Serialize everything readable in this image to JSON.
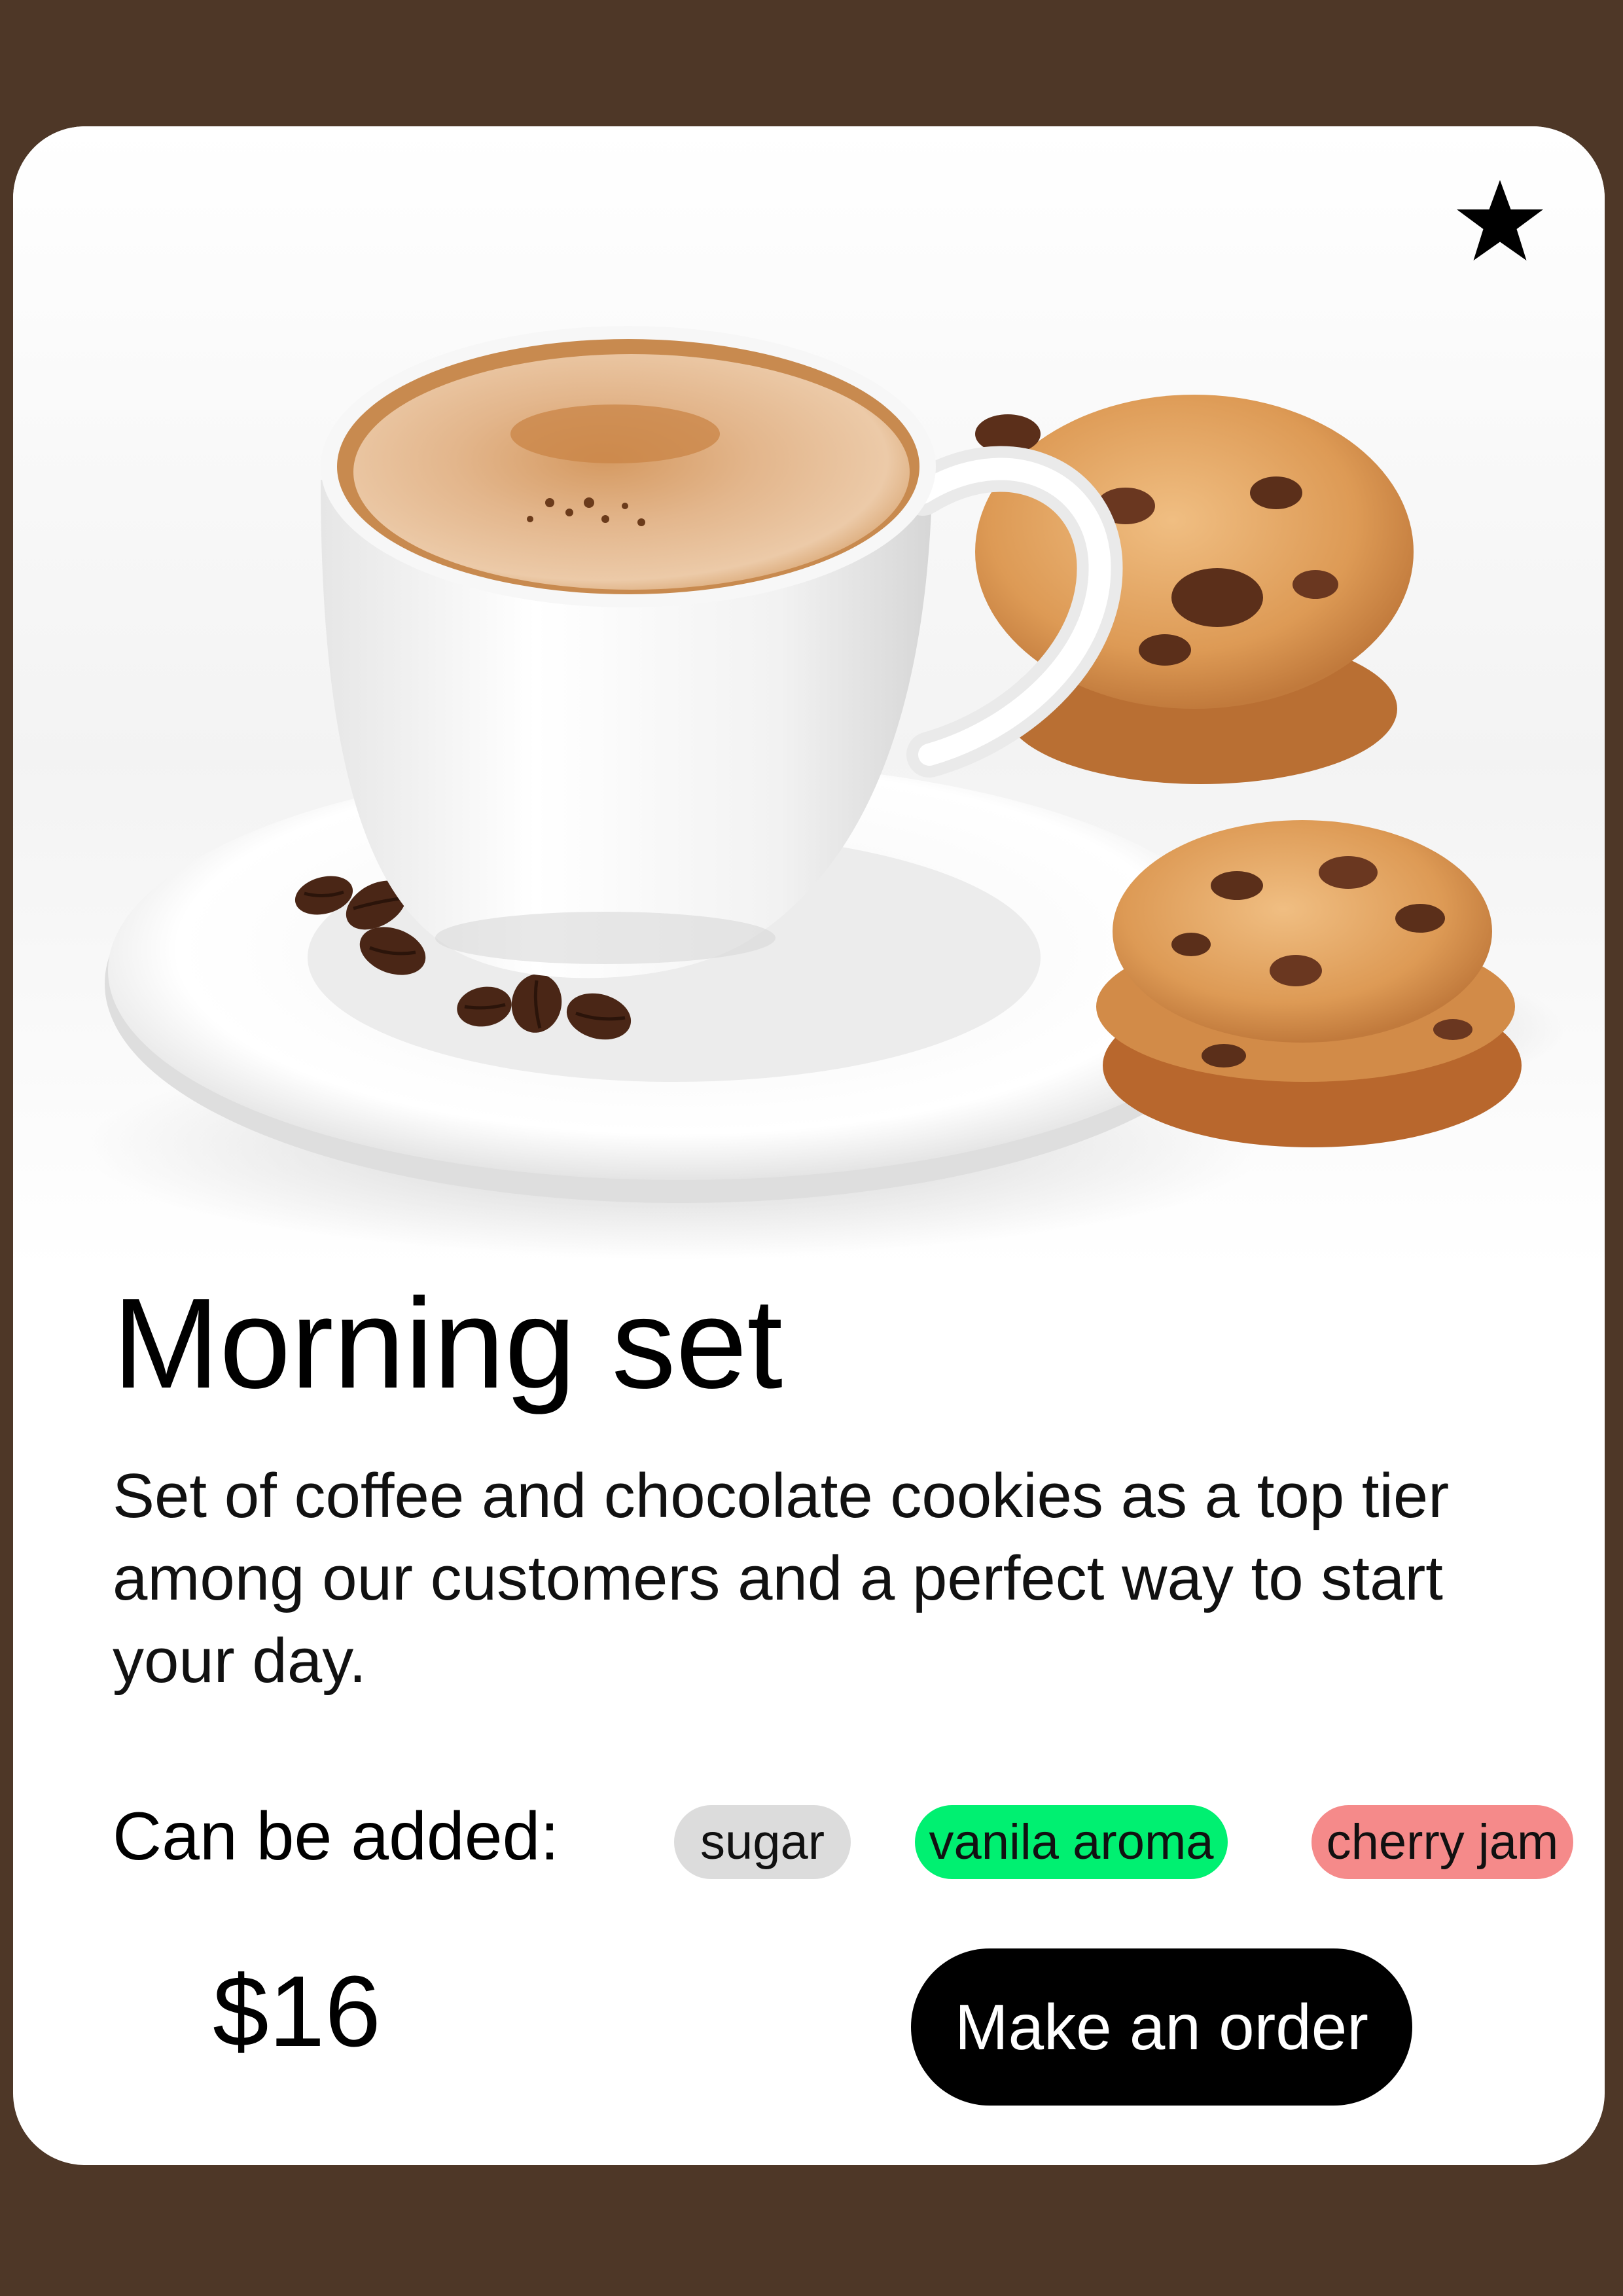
{
  "product": {
    "title": "Morning set",
    "description": "Set of coffee and chocolate cookies as a top tier among our customers and a perfect way to start your day.",
    "addons_label": "Can be added:",
    "addons": [
      {
        "label": "sugar",
        "color": "#dcdcdc"
      },
      {
        "label": "vanila aroma",
        "color": "#00f071"
      },
      {
        "label": "cherry jam",
        "color": "#f58a8a"
      }
    ],
    "price": "$16",
    "order_button": "Make an order",
    "favorite_icon": "star-icon",
    "image_subject": "coffee-cup-with-cookies"
  },
  "colors": {
    "background": "#4e3727",
    "card": "#ffffff",
    "button": "#000000"
  }
}
